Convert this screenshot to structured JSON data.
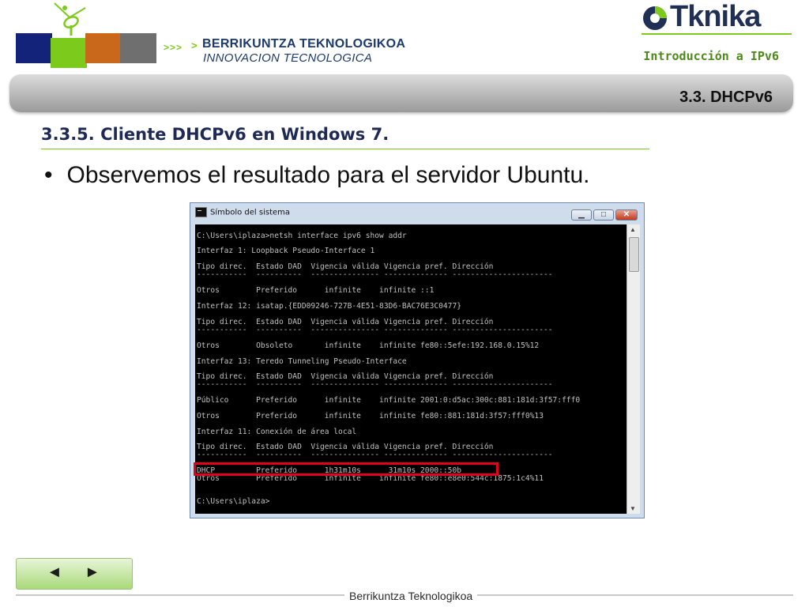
{
  "header": {
    "arrows": ">>>",
    "arrow_small": ">",
    "brand_line1": "BERRIKUNTZA TEKNOLOGIKOA",
    "brand_line2": "INNOVACION TECNOLOGICA",
    "logo_text": "Tknika",
    "topic": "Introducción a IPv6"
  },
  "band": {
    "section": "3.3. DHCPv6"
  },
  "slide": {
    "subtitle": "3.3.5. Cliente DHCPv6 en Windows 7.",
    "bullet_marker": "•",
    "bullet": "Observemos el resultado para el servidor Ubuntu."
  },
  "window": {
    "title": "Símbolo del sistema",
    "controls": {
      "min": "▁",
      "max": "□",
      "close": "✕"
    },
    "lines": [
      "C:\\Users\\iplaza>netsh interface ipv6 show addr",
      "Interfaz 1: Loopback Pseudo-Interface 1",
      "Tipo direc.  Estado DAD  Vigencia válida Vigencia pref. Dirección",
      "-----------  ----------  --------------- -------------- ----------------------",
      "Otros        Preferido      infinite    infinite ::1",
      "Interfaz 12: isatap.{EDD09246-727B-4E51-83D6-BAC76E3C0477}",
      "Tipo direc.  Estado DAD  Vigencia válida Vigencia pref. Dirección",
      "-----------  ----------  --------------- -------------- ----------------------",
      "Otros        Obsoleto       infinite    infinite fe80::5efe:192.168.0.15%12",
      "Interfaz 13: Teredo Tunneling Pseudo-Interface",
      "Tipo direc.  Estado DAD  Vigencia válida Vigencia pref. Dirección",
      "-----------  ----------  --------------- -------------- ----------------------",
      "Público      Preferido      infinite    infinite 2001:0:d5ac:300c:881:181d:3f57:fff0",
      "Otros        Preferido      infinite    infinite fe80::881:181d:3f57:fff0%13",
      "Interfaz 11: Conexión de área local",
      "Tipo direc.  Estado DAD  Vigencia válida Vigencia pref. Dirección",
      "-----------  ----------  --------------- -------------- ----------------------",
      "DHCP         Preferido      1h31m10s      31m10s 2000::50b",
      "Otros        Preferido      infinite    infinite fe80::e8e0:544c:1875:1c4%11",
      "C:\\Users\\iplaza>"
    ]
  },
  "nav": {
    "prev": "◄",
    "next": "►"
  },
  "footer": {
    "text": "Berrikuntza Teknologikoa"
  }
}
